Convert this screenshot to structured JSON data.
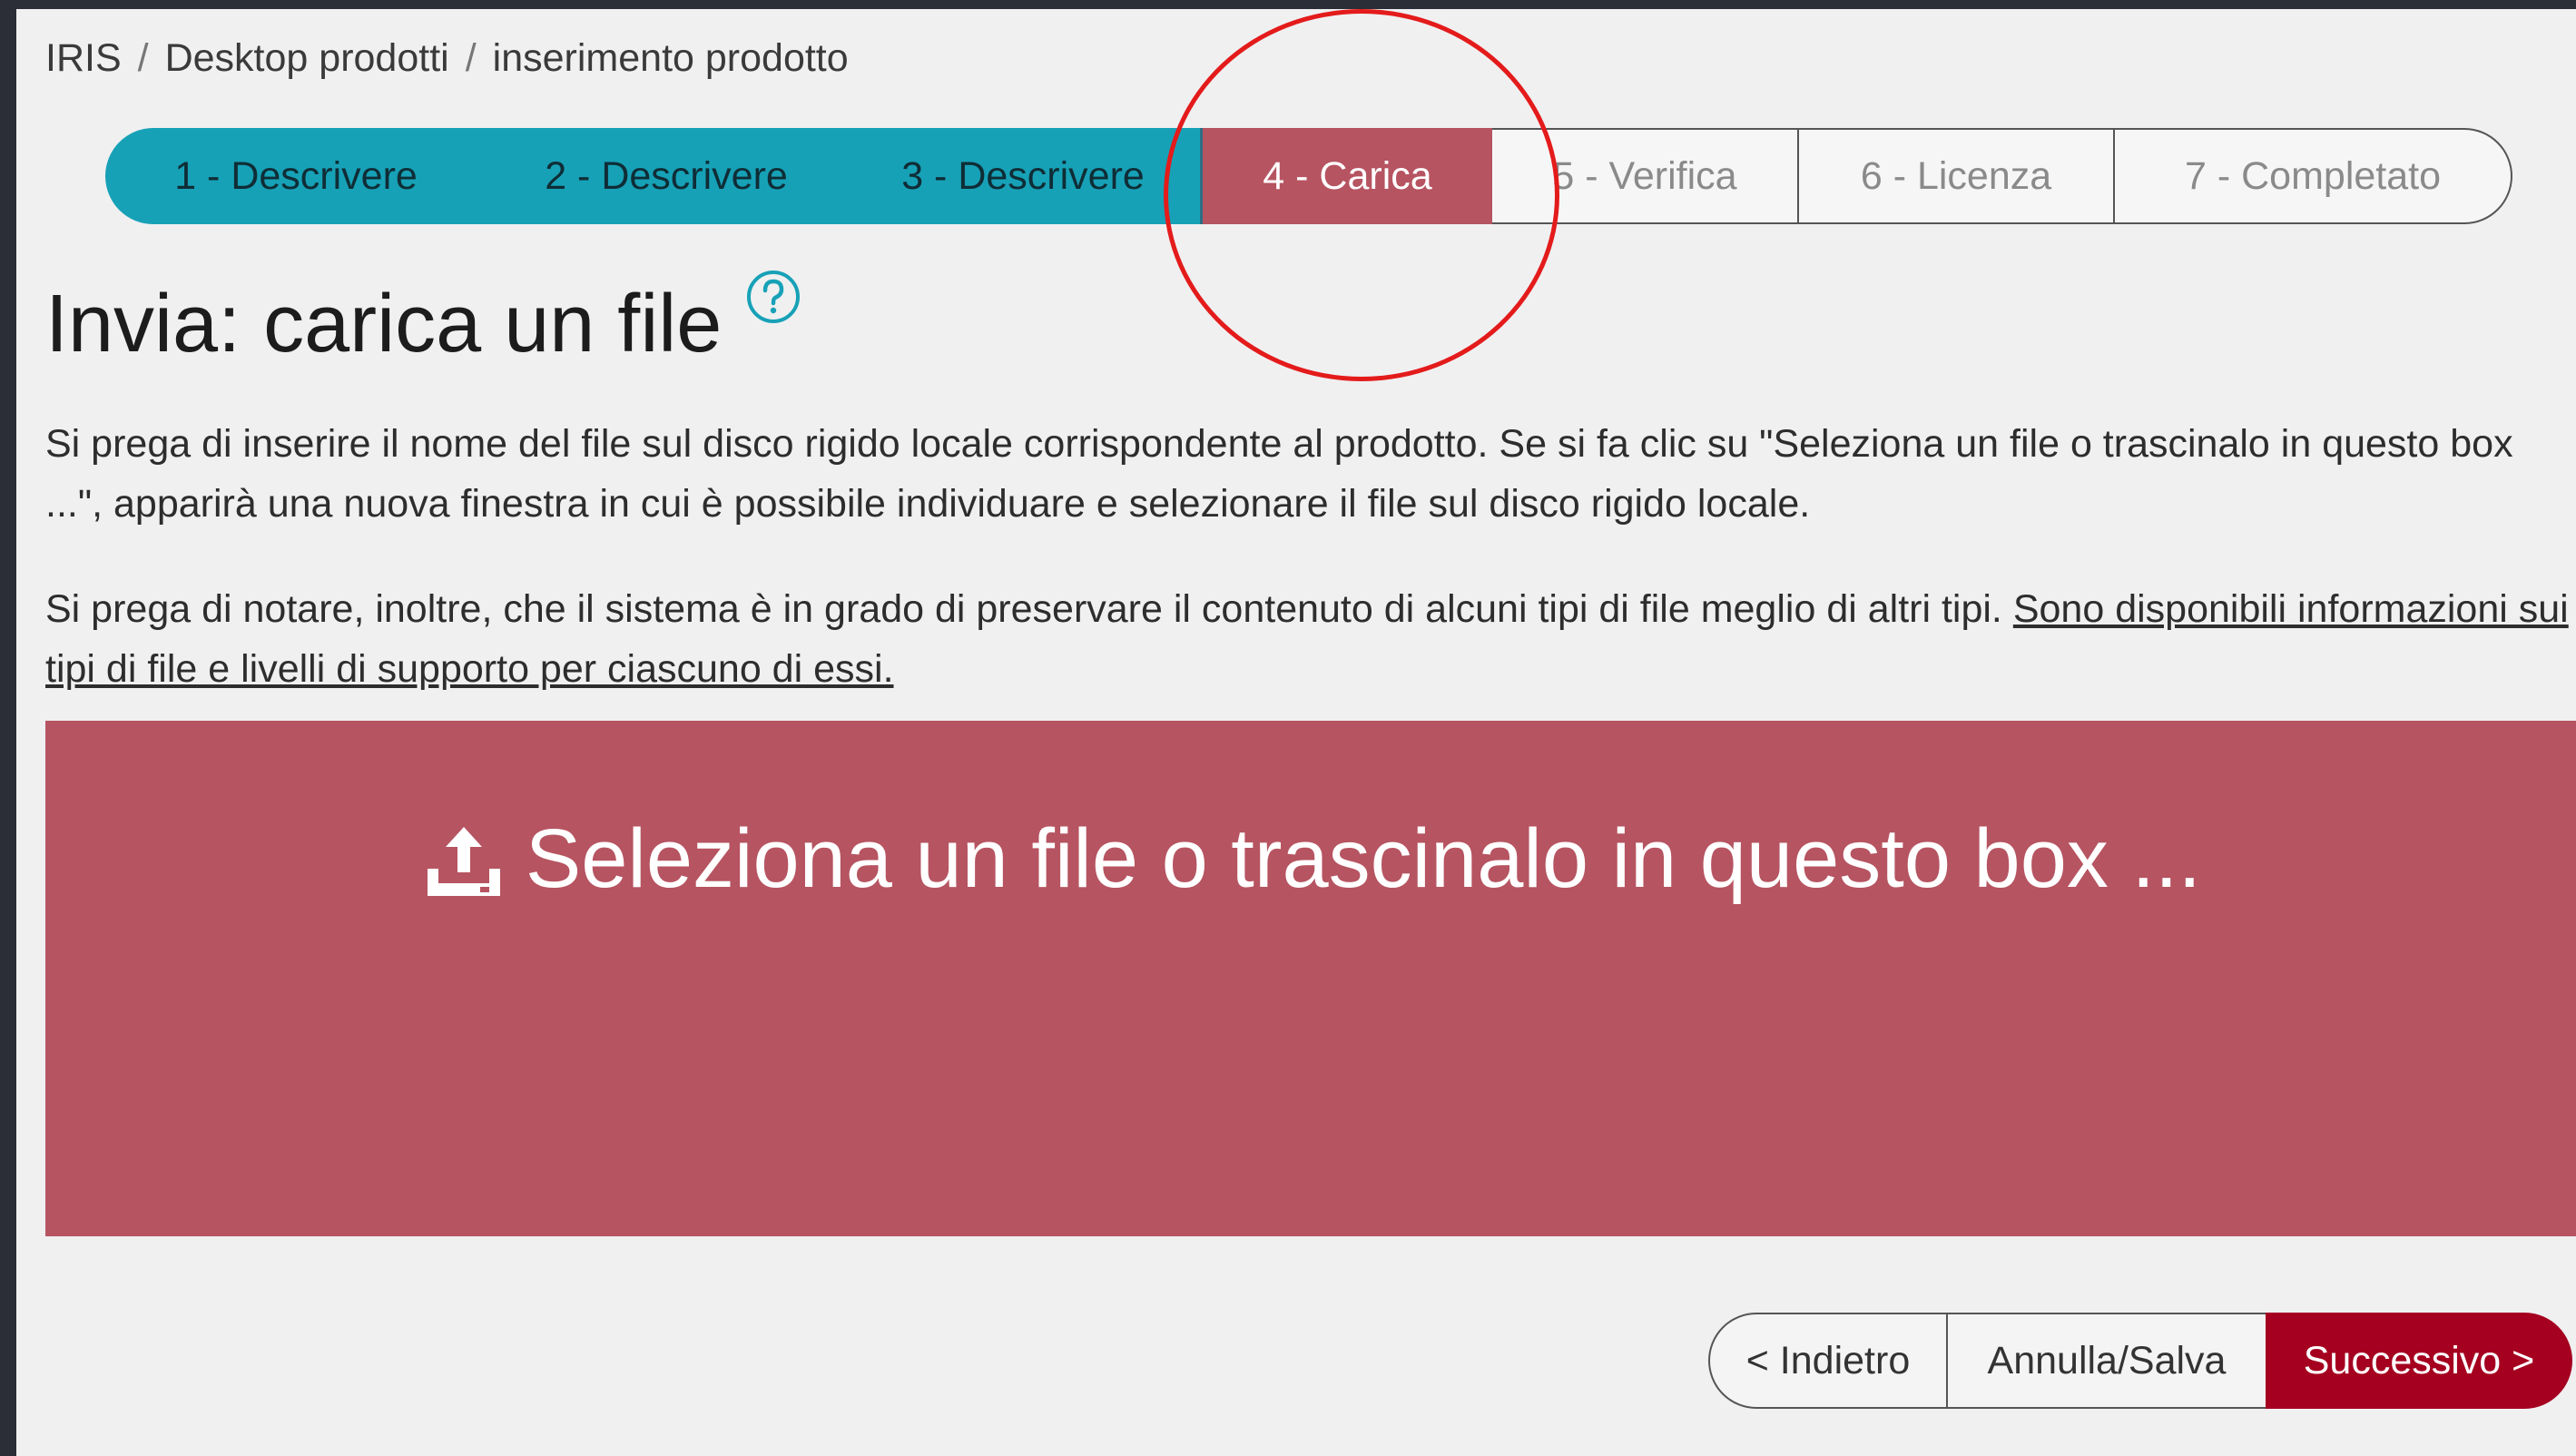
{
  "breadcrumb": {
    "items": [
      "IRIS",
      "Desktop prodotti",
      "inserimento prodotto"
    ],
    "separator": "/"
  },
  "stepper": {
    "steps": [
      {
        "label": "1 - Descrivere",
        "state": "done"
      },
      {
        "label": "2 - Descrivere",
        "state": "done"
      },
      {
        "label": "3 - Descrivere",
        "state": "done"
      },
      {
        "label": "4 - Carica",
        "state": "active"
      },
      {
        "label": "5 - Verifica",
        "state": "todo"
      },
      {
        "label": "6 - Licenza",
        "state": "todo"
      },
      {
        "label": "7 - Completato",
        "state": "todo"
      }
    ]
  },
  "page": {
    "title": "Invia: carica un file",
    "intro": "Si prega di inserire il nome del file sul disco rigido locale corrispondente al prodotto. Se si fa clic su \"Seleziona un file o trascinalo in questo box ...\", apparirà una nuova finestra in cui è possibile individuare e selezionare il file sul disco rigido locale.",
    "note_text": "Si prega di notare, inoltre, che il sistema è in grado di preservare il contenuto di alcuni tipi di file meglio di altri tipi. ",
    "note_link": "Sono disponibili informazioni sui tipi di file e livelli di supporto per ciascuno di essi."
  },
  "dropzone": {
    "label": "Seleziona un file o trascinalo in questo box ...",
    "icon": "upload-icon"
  },
  "buttons": {
    "back": "< Indietro",
    "cancel": "Annulla/Salva",
    "next": "Successivo >"
  },
  "colors": {
    "done": "#17a1b7",
    "active": "#b65461",
    "primary": "#a5001f",
    "annotation": "#e41b1b"
  }
}
